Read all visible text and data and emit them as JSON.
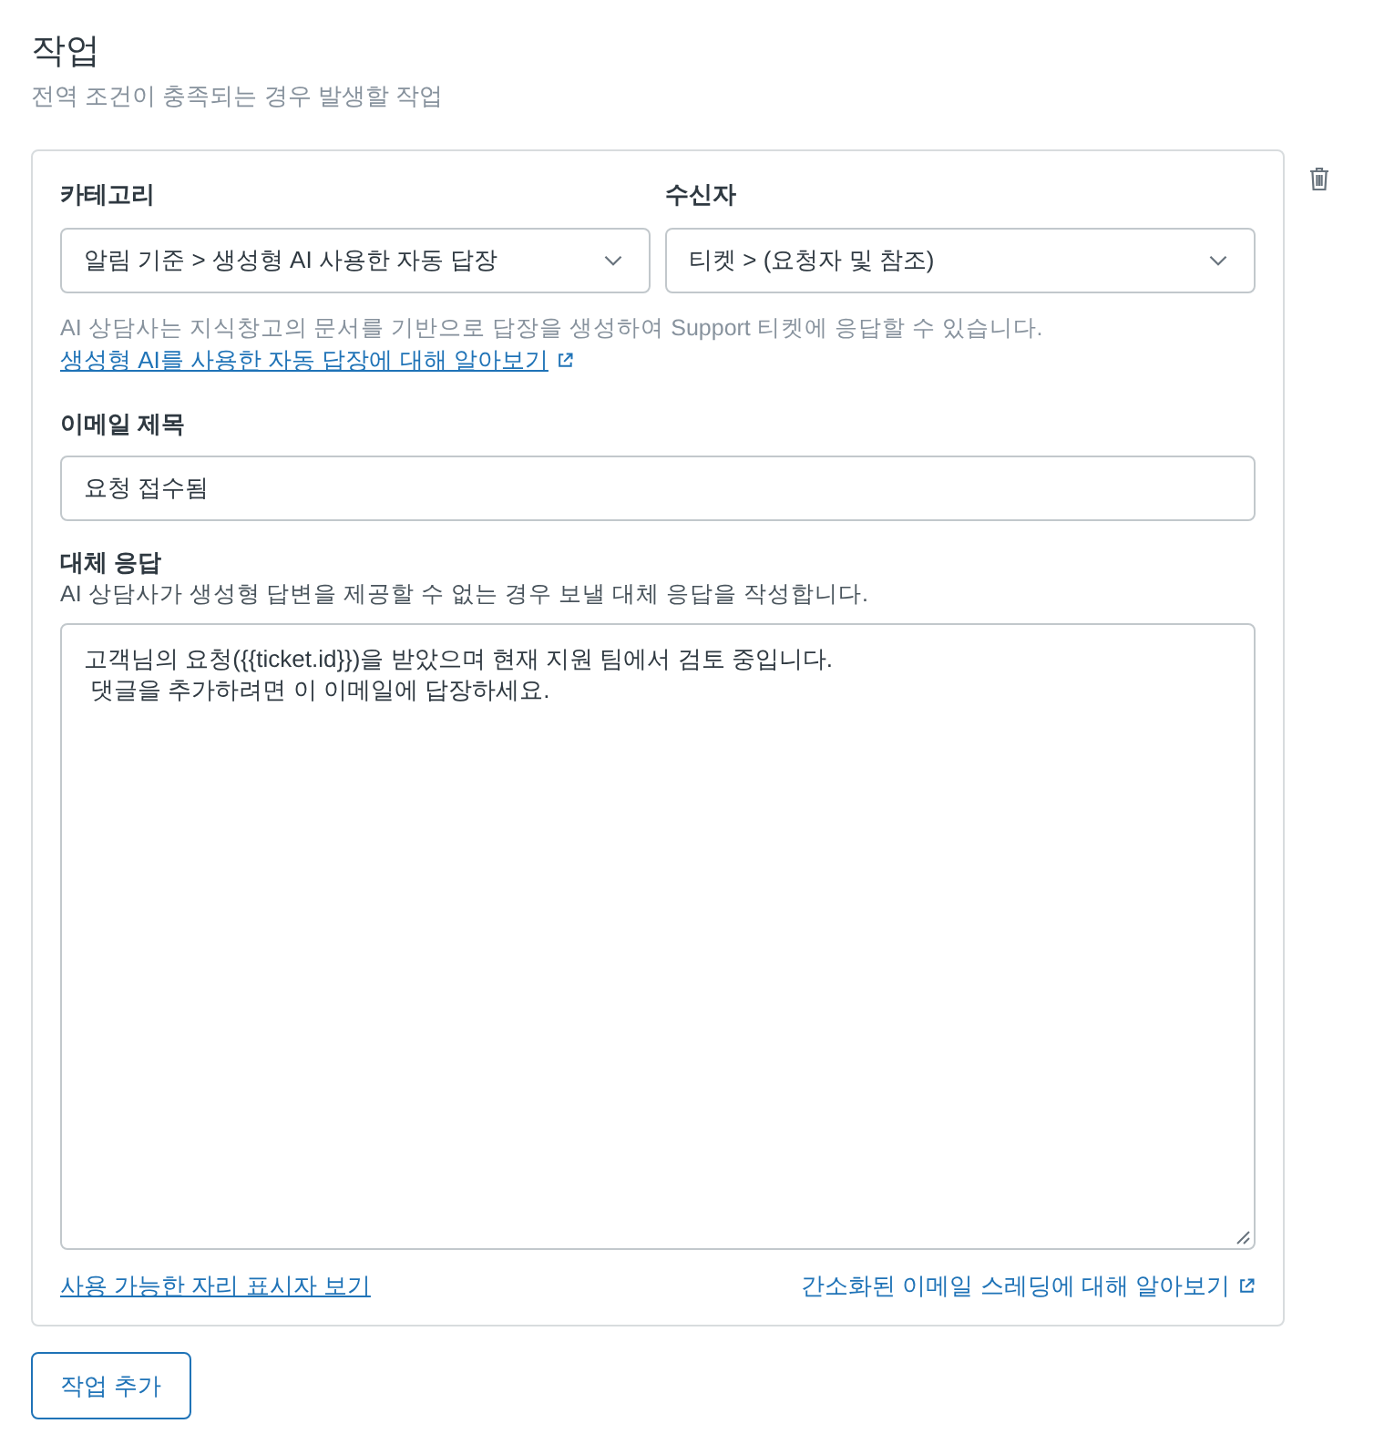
{
  "section": {
    "title": "작업",
    "subtitle": "전역 조건이 충족되는 경우 발생할 작업"
  },
  "actions": [
    {
      "selects": [
        {
          "label": "카테고리",
          "value": "알림 기준 > 생성형 AI 사용한 자동 답장"
        },
        {
          "label": "수신자",
          "value": "티켓 > (요청자 및 참조)"
        }
      ],
      "help": {
        "text": "AI 상담사는 지식창고의 문서를 기반으로 답장을 생성하여 Support 티켓에 응답할 수 있습니다.",
        "link": "생성형 AI를 사용한 자동 답장에 대해 알아보기"
      },
      "subject": {
        "label": "이메일 제목",
        "value": "요청 접수됨"
      },
      "fallback": {
        "label": "대체 응답",
        "description": "AI 상담사가 생성형 답변을 제공할 수 없는 경우 보낼 대체 응답을 작성합니다.",
        "value": "고객님의 요청({{ticket.id}})을 받았으며 현재 지원 팀에서 검토 중입니다.\n 댓글을 추가하려면 이 이메일에 답장하세요."
      },
      "links": [
        {
          "kind": "placeholders",
          "label": "사용 가능한 자리 표시자 보기"
        },
        {
          "kind": "external",
          "label": "간소화된 이메일 스레딩에 대해 알아보기"
        }
      ]
    }
  ],
  "add_button": "작업 추가"
}
